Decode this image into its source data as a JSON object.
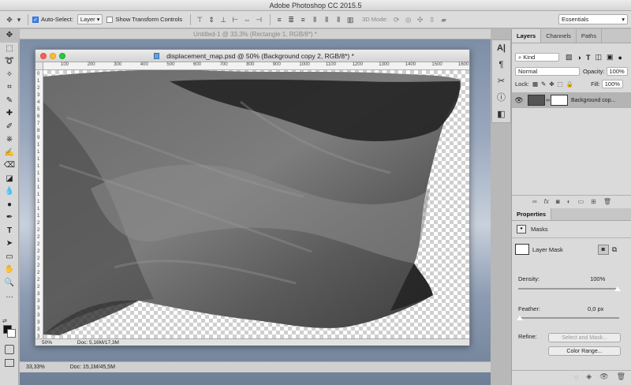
{
  "app_title": "Adobe Photoshop CC 2015.5",
  "options": {
    "auto_select_label": "Auto-Select:",
    "auto_select_checked": true,
    "auto_select_target": "Layer",
    "show_transform_label": "Show Transform Controls",
    "mode_3d_label": "3D Mode:",
    "workspace": "Essentials"
  },
  "background_doc": {
    "title": "Untitled-1 @ 33,3% (Rectangle 1, RGB/8*) *",
    "zoom": "33,33%",
    "doc_size": "Doc: 15,1M/45,5M"
  },
  "active_doc": {
    "title": "displacement_map.psd @ 50% (Background copy 2, RGB/8*) *",
    "zoom": "50%",
    "doc_size": "Doc: 5,16M/17,3M",
    "ruler_ticks": [
      "100",
      "200",
      "300",
      "400",
      "500",
      "600",
      "700",
      "800",
      "900",
      "1000",
      "1100",
      "1200",
      "1300",
      "1400",
      "1500",
      "1600"
    ],
    "ruler_ticks_left": [
      "0",
      "1",
      "2",
      "3",
      "4",
      "5",
      "6",
      "7",
      "8",
      "9",
      "1",
      "1",
      "1",
      "1",
      "1",
      "1",
      "1",
      "1",
      "1",
      "1",
      "1",
      "2",
      "2",
      "2",
      "2",
      "2",
      "2",
      "2",
      "2",
      "2",
      "2",
      "3",
      "3",
      "3",
      "3",
      "3",
      "3",
      "3"
    ]
  },
  "layers_panel": {
    "tabs": [
      "Layers",
      "Channels",
      "Paths"
    ],
    "active_tab": "Layers",
    "filter_label": "Kind",
    "blend_mode": "Normal",
    "opacity_label": "Opacity:",
    "opacity_value": "100%",
    "lock_label": "Lock:",
    "fill_label": "Fill:",
    "fill_value": "100%",
    "layer_name": "Background cop..."
  },
  "properties_panel": {
    "title": "Properties",
    "section": "Masks",
    "mask_type": "Layer Mask",
    "density_label": "Density:",
    "density_value": "100%",
    "feather_label": "Feather:",
    "feather_value": "0,0 px",
    "refine_label": "Refine:",
    "select_mask_button": "Select and Mask...",
    "color_range_button": "Color Range..."
  },
  "colors": {
    "panel_bg": "#dadada",
    "flag_dark": "#2a2a2a",
    "flag_mid": "#5e5e5e",
    "flag_light": "#8a8a8a"
  }
}
